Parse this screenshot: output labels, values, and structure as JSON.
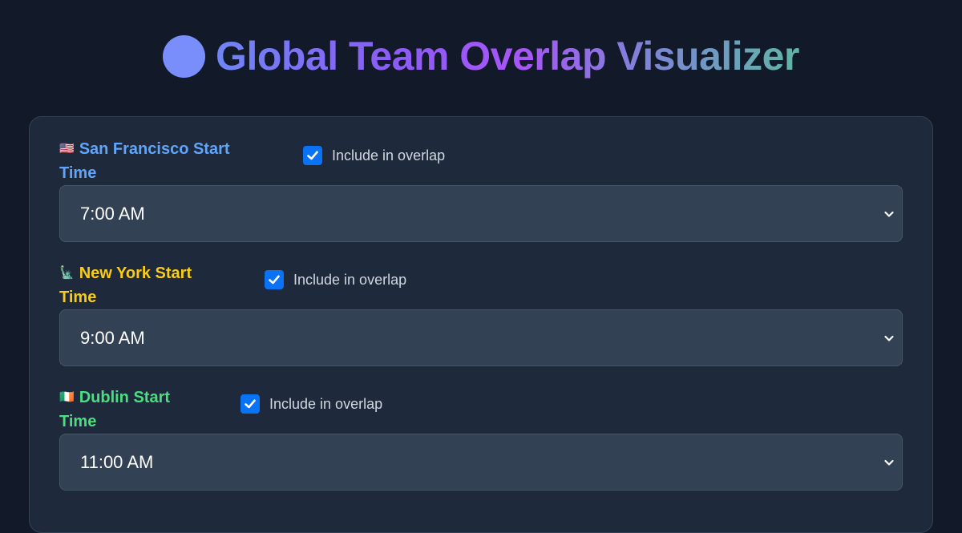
{
  "header": {
    "title": "Global Team Overlap Visualizer",
    "logo_icon": "circle-logo-icon"
  },
  "colors": {
    "sf": "#60a5fa",
    "ny": "#facc15",
    "dublin": "#4ade80",
    "checkbox": "#0a72f5"
  },
  "teams": [
    {
      "flag": "🇺🇸",
      "label_line1": "San Francisco Start",
      "label_line2": "Time",
      "include_label": "Include in overlap",
      "checked": true,
      "value": "7:00 AM"
    },
    {
      "flag": "🗽",
      "label_line1": "New York Start",
      "label_line2": "Time",
      "include_label": "Include in overlap",
      "checked": true,
      "value": "9:00 AM"
    },
    {
      "flag": "🇮🇪",
      "label_line1": "Dublin Start",
      "label_line2": "Time",
      "include_label": "Include in overlap",
      "checked": true,
      "value": "11:00 AM"
    }
  ]
}
